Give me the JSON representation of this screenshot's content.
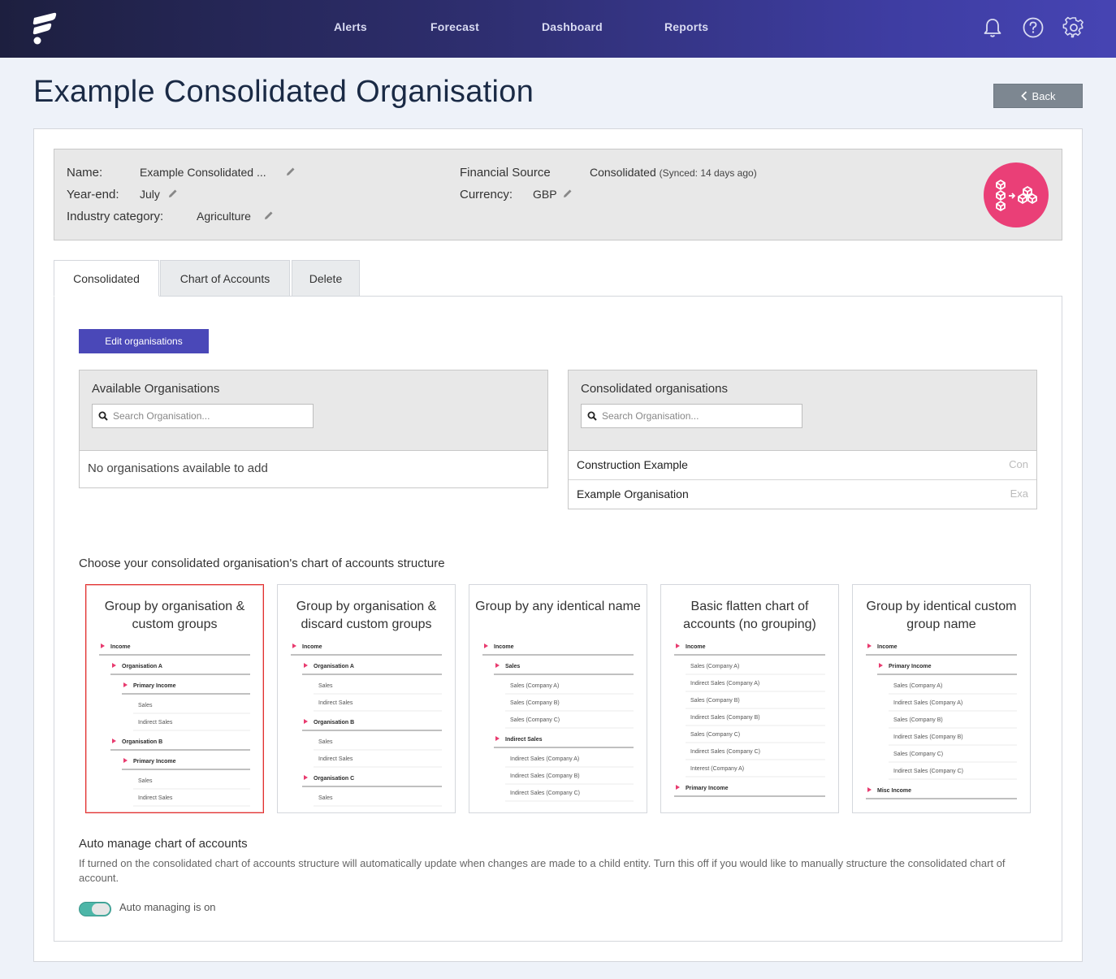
{
  "nav": {
    "links": [
      "Alerts",
      "Forecast",
      "Dashboard",
      "Reports"
    ],
    "icons": [
      "bell-icon",
      "help-icon",
      "gear-icon"
    ]
  },
  "page": {
    "title": "Example Consolidated Organisation",
    "back_label": "Back"
  },
  "info": {
    "name_label": "Name:",
    "name_value": "Example Consolidated ...",
    "yearend_label": "Year-end:",
    "yearend_value": "July",
    "industry_label": "Industry category:",
    "industry_value": "Agriculture",
    "source_label": "Financial Source",
    "source_value": "Consolidated",
    "source_sync": "(Synced: 14 days ago)",
    "currency_label": "Currency:",
    "currency_value": "GBP"
  },
  "tabs": [
    "Consolidated",
    "Chart of Accounts",
    "Delete"
  ],
  "edit_button": "Edit organisations",
  "available": {
    "title": "Available Organisations",
    "search_placeholder": "Search Organisation...",
    "empty": "No organisations available to add"
  },
  "consolidated": {
    "title": "Consolidated organisations",
    "search_placeholder": "Search Organisation...",
    "rows": [
      {
        "name": "Construction Example",
        "code": "Con"
      },
      {
        "name": "Example Organisation",
        "code": "Exa"
      }
    ]
  },
  "structure": {
    "prompt": "Choose your consolidated organisation's chart of accounts structure",
    "options": [
      {
        "title": "Group by organisation & custom groups",
        "selected": true,
        "tree": [
          [
            "h",
            0,
            "Income"
          ],
          [
            "h",
            1,
            "Organisation A"
          ],
          [
            "h",
            2,
            "Primary Income"
          ],
          [
            "i",
            3,
            "Sales"
          ],
          [
            "i",
            3,
            "Indirect Sales"
          ],
          [
            "h",
            1,
            "Organisation B"
          ],
          [
            "h",
            2,
            "Primary Income"
          ],
          [
            "i",
            3,
            "Sales"
          ],
          [
            "i",
            3,
            "Indirect Sales"
          ]
        ]
      },
      {
        "title": "Group by organisation & discard custom groups",
        "selected": false,
        "tree": [
          [
            "h",
            0,
            "Income"
          ],
          [
            "h",
            1,
            "Organisation A"
          ],
          [
            "i",
            2,
            "Sales"
          ],
          [
            "i",
            2,
            "Indirect Sales"
          ],
          [
            "h",
            1,
            "Organisation B"
          ],
          [
            "i",
            2,
            "Sales"
          ],
          [
            "i",
            2,
            "Indirect Sales"
          ],
          [
            "h",
            1,
            "Organisation C"
          ],
          [
            "i",
            2,
            "Sales"
          ]
        ]
      },
      {
        "title": "Group by any identical name",
        "selected": false,
        "tree": [
          [
            "h",
            0,
            "Income"
          ],
          [
            "h",
            1,
            "Sales"
          ],
          [
            "i",
            2,
            "Sales (Company A)"
          ],
          [
            "i",
            2,
            "Sales (Company B)"
          ],
          [
            "i",
            2,
            "Sales (Company C)"
          ],
          [
            "h",
            1,
            "Indirect Sales"
          ],
          [
            "i",
            2,
            "Indirect Sales (Company A)"
          ],
          [
            "i",
            2,
            "Indirect Sales (Company B)"
          ],
          [
            "i",
            2,
            "Indirect Sales (Company C)"
          ]
        ]
      },
      {
        "title": "Basic flatten chart of accounts (no grouping)",
        "selected": false,
        "tree": [
          [
            "h",
            0,
            "Income"
          ],
          [
            "i",
            1,
            "Sales (Company A)"
          ],
          [
            "i",
            1,
            "Indirect Sales (Company A)"
          ],
          [
            "i",
            1,
            "Sales (Company B)"
          ],
          [
            "i",
            1,
            "Indirect Sales (Company B)"
          ],
          [
            "i",
            1,
            "Sales (Company C)"
          ],
          [
            "i",
            1,
            "Indirect Sales (Company C)"
          ],
          [
            "i",
            1,
            "Interest (Company A)"
          ],
          [
            "h",
            0,
            "Primary Income"
          ]
        ]
      },
      {
        "title": "Group by identical custom group name",
        "selected": false,
        "tree": [
          [
            "h",
            0,
            "Income"
          ],
          [
            "h",
            1,
            "Primary Income"
          ],
          [
            "i",
            2,
            "Sales (Company A)"
          ],
          [
            "i",
            2,
            "Indirect Sales (Company A)"
          ],
          [
            "i",
            2,
            "Sales (Company B)"
          ],
          [
            "i",
            2,
            "Indirect Sales (Company B)"
          ],
          [
            "i",
            2,
            "Sales (Company C)"
          ],
          [
            "i",
            2,
            "Indirect Sales (Company C)"
          ],
          [
            "h",
            0,
            "Misc Income"
          ]
        ]
      }
    ]
  },
  "auto_manage": {
    "title": "Auto manage chart of accounts",
    "description": "If turned on the consolidated chart of accounts structure will automatically update when changes are made to a child entity. Turn this off if you would like to manually structure the consolidated chart of account.",
    "toggle_label": "Auto managing is on",
    "enabled": true
  },
  "colors": {
    "accent": "#4a48b8",
    "badge": "#ea3f77",
    "selected_border": "#e3302f",
    "toggle_on": "#4db6a8"
  }
}
